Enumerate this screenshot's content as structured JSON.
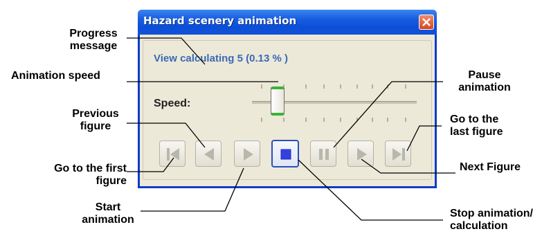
{
  "window": {
    "title": "Hazard scenery animation",
    "close_icon": "close-icon"
  },
  "progress": {
    "message": "View calculating 5 (0.13 % )"
  },
  "speed": {
    "label": "Speed:",
    "value_fraction": 0.15
  },
  "buttons": [
    {
      "name": "go-to-first-button",
      "icon": "skip-to-start-icon"
    },
    {
      "name": "previous-figure-button",
      "icon": "step-back-icon"
    },
    {
      "name": "start-animation-button",
      "icon": "play-icon"
    },
    {
      "name": "stop-button",
      "icon": "stop-icon",
      "active": true
    },
    {
      "name": "pause-button",
      "icon": "pause-icon"
    },
    {
      "name": "next-figure-button",
      "icon": "step-forward-icon"
    },
    {
      "name": "go-to-last-button",
      "icon": "skip-to-end-icon"
    }
  ],
  "callouts": {
    "progress_message": [
      "Progress",
      "message"
    ],
    "animation_speed": "Animation speed",
    "previous_figure": [
      "Previous",
      "figure"
    ],
    "go_to_first": [
      "Go to the first",
      "figure"
    ],
    "start_animation": [
      "Start",
      "animation"
    ],
    "pause_animation": [
      "Pause",
      "animation"
    ],
    "go_to_last": [
      "Go to the",
      "last figure"
    ],
    "next_figure": "Next Figure",
    "stop_animation": [
      "Stop animation/",
      "calculation"
    ]
  },
  "colors": {
    "title_bar": "#0b4fd8",
    "progress_text": "#3a69b8",
    "thumb_accent": "#3bb13b",
    "stop_icon": "#3340e0"
  }
}
